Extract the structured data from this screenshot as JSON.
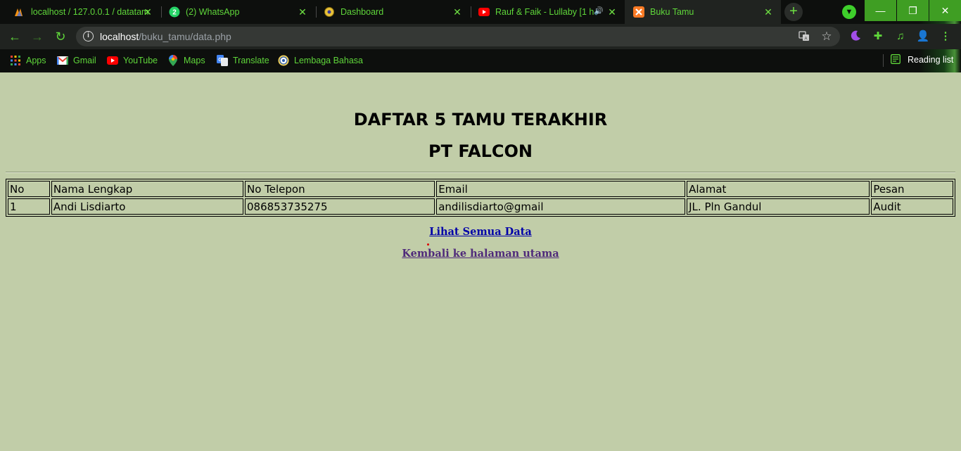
{
  "browser": {
    "tabs": [
      {
        "title": "localhost / 127.0.0.1 / datatam",
        "icon": "phpmyadmin-icon"
      },
      {
        "title": "(2) WhatsApp",
        "icon": "whatsapp-icon"
      },
      {
        "title": "Dashboard",
        "icon": "dashboard-icon"
      },
      {
        "title": "Rauf & Faik - Lullaby [1 h",
        "icon": "youtube-icon"
      },
      {
        "title": "Buku Tamu",
        "icon": "xampp-icon"
      }
    ],
    "url_host": "localhost",
    "url_path": "/buku_tamu/data.php",
    "bookmarks": [
      {
        "label": "Apps",
        "icon": "apps-grid-icon"
      },
      {
        "label": "Gmail",
        "icon": "gmail-icon"
      },
      {
        "label": "YouTube",
        "icon": "youtube-icon"
      },
      {
        "label": "Maps",
        "icon": "maps-icon"
      },
      {
        "label": "Translate",
        "icon": "translate-icon"
      },
      {
        "label": "Lembaga Bahasa",
        "icon": "lembaga-bahasa-icon"
      }
    ],
    "reading_list": "Reading list",
    "colors": {
      "accent": "#5fd63a",
      "window_buttons": "#3f9e23",
      "page_background": "#c1cda8"
    }
  },
  "page": {
    "title": "DAFTAR 5 TAMU TERAKHIR",
    "subtitle": "PT FALCON",
    "table": {
      "headers": [
        "No",
        "Nama Lengkap",
        "No Telepon",
        "Email",
        "Alamat",
        "Pesan"
      ],
      "rows": [
        [
          "1",
          "Andi Lisdiarto",
          "086853735275",
          "andilisdiarto@gmail",
          "JL. Pln Gandul",
          "Audit"
        ]
      ]
    },
    "link_all": "Lihat Semua Data",
    "link_home": "Kembali ke halaman utama"
  }
}
